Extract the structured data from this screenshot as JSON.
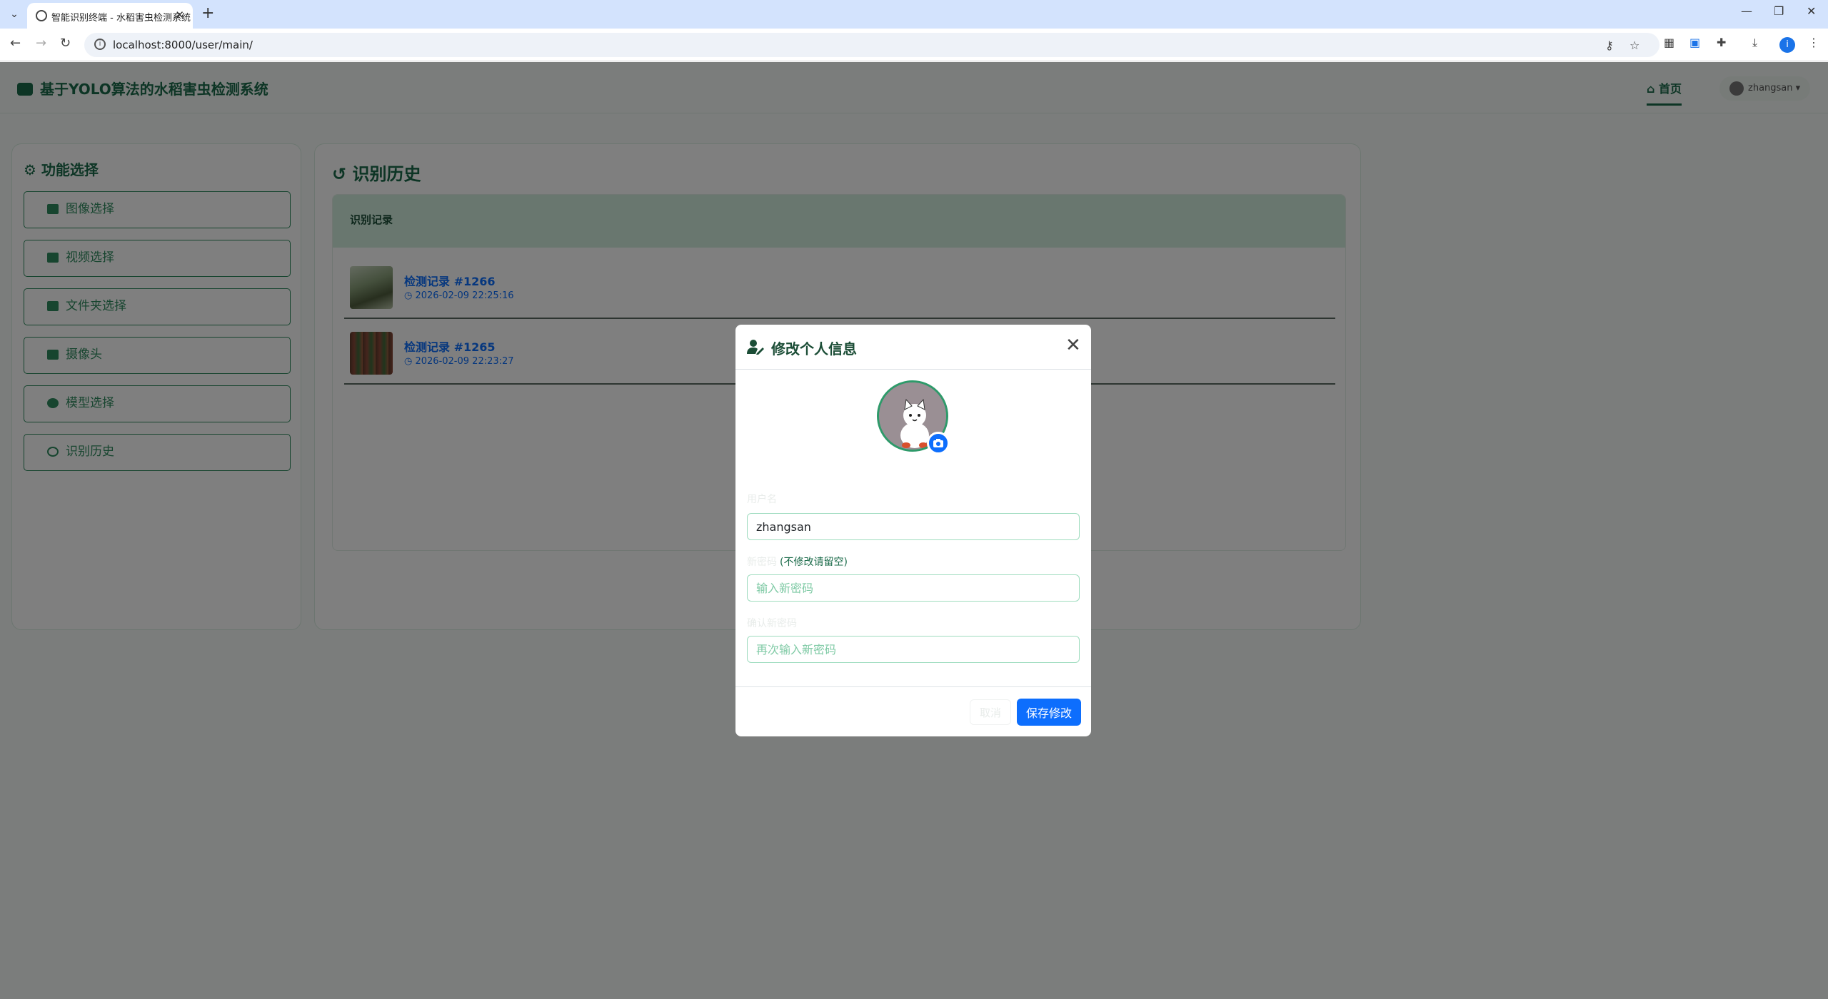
{
  "browser": {
    "tab_title": "智能识别终端 - 水稻害虫检测系统",
    "url": "localhost:8000/user/main/"
  },
  "app": {
    "brand": "基于YOLO算法的水稻害虫检测系统",
    "nav_home": "首页",
    "username": "zhangsan"
  },
  "sidebar": {
    "title": "功能选择",
    "items": [
      {
        "label": "图像选择",
        "icon": "image-icon"
      },
      {
        "label": "视频选择",
        "icon": "video-icon"
      },
      {
        "label": "文件夹选择",
        "icon": "folder-icon"
      },
      {
        "label": "摄像头",
        "icon": "camera-icon"
      },
      {
        "label": "模型选择",
        "icon": "brain-icon"
      },
      {
        "label": "识别历史",
        "icon": "history-icon"
      }
    ]
  },
  "main": {
    "title": "识别历史",
    "card_header": "识别记录",
    "records": [
      {
        "title": "检测记录 #1266",
        "time": "2026-02-09 22:25:16"
      },
      {
        "title": "检测记录 #1265",
        "time": "2026-02-09 22:23:27"
      }
    ]
  },
  "modal": {
    "title": "修改个人信息",
    "username_label": "用户名",
    "username_value": "zhangsan",
    "password_label": "新密码",
    "password_hint": "(不修改请留空)",
    "password_placeholder": "输入新密码",
    "confirm_label": "确认新密码",
    "confirm_placeholder": "再次输入新密码",
    "cancel_label": "取消",
    "save_label": "保存修改"
  },
  "colors": {
    "primary_green": "#1b6b4a",
    "accent_blue": "#0d6efd"
  }
}
